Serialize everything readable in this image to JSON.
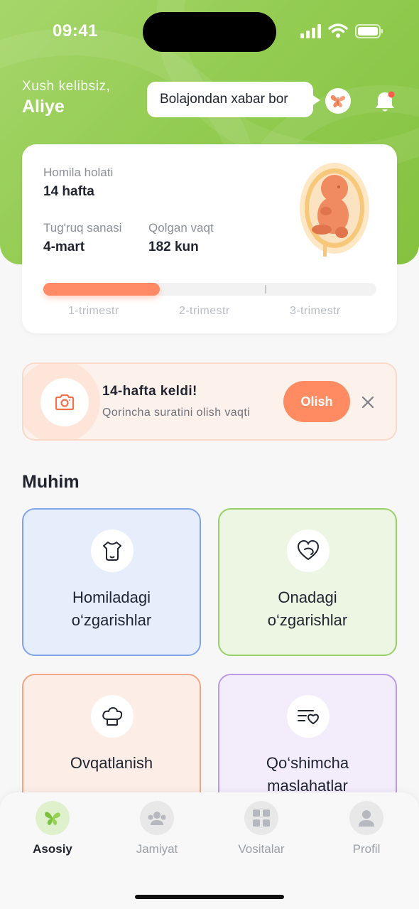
{
  "status_bar": {
    "time": "09:41"
  },
  "header": {
    "greeting": "Xush kelibsiz,",
    "name": "Aliye",
    "bubble_text": "Bolajondan xabar bor"
  },
  "pregnancy_card": {
    "status_label": "Homila holati",
    "status_value": "14 hafta",
    "due_label": "Tug'ruq sanasi",
    "due_value": "4-mart",
    "remaining_label": "Qolgan vaqt",
    "remaining_value": "182 kun",
    "progress_fraction": 0.35,
    "trimesters": [
      "1-trimestr",
      "2-trimestr",
      "3-trimestr"
    ]
  },
  "alert": {
    "title": "14-hafta keldi!",
    "subtitle": "Qorincha suratini olish vaqti",
    "action_label": "Olish"
  },
  "section_title": "Muhim",
  "tiles": [
    {
      "label": "Homiladagi\no‘zgarishlar",
      "icon": "onesie-icon",
      "bg": "#e6eefb",
      "border": "#7fa4ea"
    },
    {
      "label": "Onadagi\no‘zgarishlar",
      "icon": "heart-icon",
      "bg": "#edf5e3",
      "border": "#98cf67"
    },
    {
      "label": "Ovqatlanish",
      "icon": "chef-hat-icon",
      "bg": "#fcede6",
      "border": "#f4a585"
    },
    {
      "label": "Qo‘shimcha\nmaslahatlar",
      "icon": "list-heart-icon",
      "bg": "#f2ecfb",
      "border": "#b99ae6"
    }
  ],
  "tabs": [
    {
      "label": "Asosiy",
      "icon": "butterfly-icon",
      "active": true
    },
    {
      "label": "Jamiyat",
      "icon": "community-icon",
      "active": false
    },
    {
      "label": "Vositalar",
      "icon": "grid-icon",
      "active": false
    },
    {
      "label": "Profil",
      "icon": "profile-icon",
      "active": false
    }
  ],
  "colors": {
    "accent_green": "#8cc84b",
    "accent_orange": "#ff8b62"
  }
}
